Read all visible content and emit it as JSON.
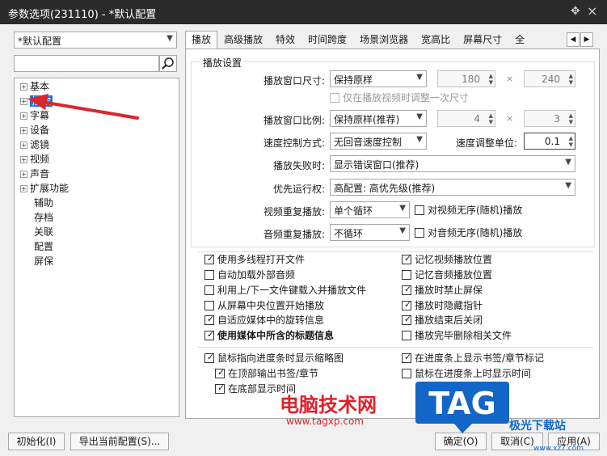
{
  "window": {
    "title": "参数选项(231110) - *默认配置",
    "pin_glyph": "✥",
    "close_glyph": "×"
  },
  "profile": {
    "selected": "*默认配置"
  },
  "tree": {
    "items": [
      {
        "label": "基本",
        "expandable": true
      },
      {
        "label": "播放",
        "expandable": true,
        "selected": true
      },
      {
        "label": "字幕",
        "expandable": true
      },
      {
        "label": "设备",
        "expandable": true
      },
      {
        "label": "滤镜",
        "expandable": true
      },
      {
        "label": "视频",
        "expandable": true
      },
      {
        "label": "声音",
        "expandable": true
      },
      {
        "label": "扩展功能",
        "expandable": true
      },
      {
        "label": "辅助",
        "expandable": false
      },
      {
        "label": "存档",
        "expandable": false
      },
      {
        "label": "关联",
        "expandable": false
      },
      {
        "label": "配置",
        "expandable": false
      },
      {
        "label": "屏保",
        "expandable": false
      }
    ]
  },
  "tabs": [
    "播放",
    "高级播放",
    "特效",
    "时间跨度",
    "场景浏览器",
    "宽高比",
    "屏幕尺寸",
    "全"
  ],
  "settings": {
    "group_title": "播放设置",
    "window_size": {
      "label": "播放窗口尺寸:",
      "value": "保持原样",
      "width": "180",
      "height": "240",
      "times": "×"
    },
    "adjust_once": "仅在播放视频时调整一次尺寸",
    "window_ratio": {
      "label": "播放窗口比例:",
      "value": "保持原样(推荐)",
      "w": "4",
      "h": "3",
      "times": "×"
    },
    "speed_mode": {
      "label": "速度控制方式:",
      "value": "无回音速度控制"
    },
    "speed_unit": {
      "label": "速度调整单位:",
      "value": "0.1"
    },
    "on_fail": {
      "label": "播放失败时:",
      "value": "显示错误窗口(推荐)"
    },
    "priority": {
      "label": "优先运行权:",
      "value": "高配置: 高优先级(推荐)"
    },
    "video_repeat": {
      "label": "视频重复播放:",
      "value": "单个循环",
      "random": "对视频无序(随机)播放"
    },
    "audio_repeat": {
      "label": "音频重复播放:",
      "value": "不循环",
      "random": "对音频无序(随机)播放"
    }
  },
  "checks_left": [
    {
      "label": "使用多线程打开文件",
      "checked": true
    },
    {
      "label": "自动加载外部音频",
      "checked": false
    },
    {
      "label": "利用上/下一文件键载入并播放文件",
      "checked": false
    },
    {
      "label": "从屏幕中央位置开始播放",
      "checked": false
    },
    {
      "label": "自适应媒体中的旋转信息",
      "checked": true
    },
    {
      "label": "使用媒体中所含的标题信息",
      "checked": true
    }
  ],
  "checks_right": [
    {
      "label": "记忆视频播放位置",
      "checked": true
    },
    {
      "label": "记忆音频播放位置",
      "checked": false
    },
    {
      "label": "播放时禁止屏保",
      "checked": true
    },
    {
      "label": "播放时隐藏指针",
      "checked": true
    },
    {
      "label": "播放结束后关闭",
      "checked": true
    },
    {
      "label": "播放完毕删除相关文件",
      "checked": false
    }
  ],
  "thumb_checks": [
    {
      "label": "鼠标指向进度条时显示缩略图",
      "checked": true
    },
    {
      "label": "在顶部输出书签/章节",
      "checked": true
    },
    {
      "label": "在底部显示时间",
      "checked": true
    }
  ],
  "bar_checks": [
    {
      "label": "在进度条上显示书签/章节标记",
      "checked": true
    },
    {
      "label": "鼠标在进度条上时显示时间",
      "checked": false
    }
  ],
  "buttons": {
    "init": "初始化(I)",
    "export": "导出当前配置(S)...",
    "ok": "确定(O)",
    "cancel": "取消(C)",
    "apply": "应用(A)"
  },
  "watermark": {
    "cn": "电脑技术网",
    "url": "www.tagxp.com",
    "logo": "TAG",
    "site": "极光下载站",
    "site_url": "www.xz7.com"
  },
  "colors": {
    "accent": "#2c6fd0",
    "arrow": "#d9262c",
    "logo_blue": "#1266c7"
  }
}
